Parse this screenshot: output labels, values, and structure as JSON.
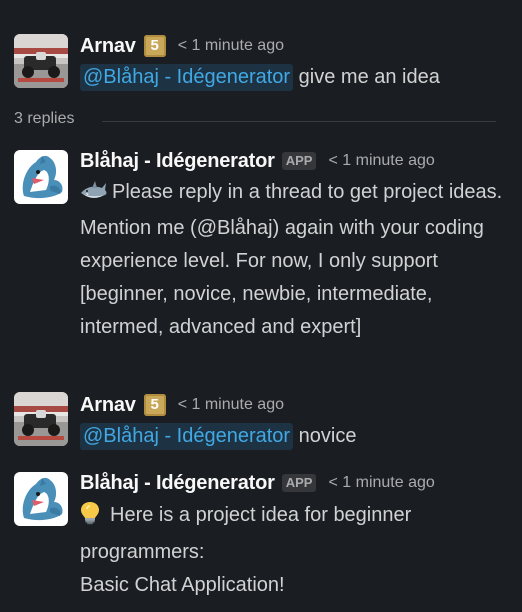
{
  "messages": [
    {
      "author": "Arnav",
      "badge": "5",
      "time": "< 1 minute ago",
      "mention": "@Blåhaj - Idégenerator",
      "text": "give me an idea"
    },
    {
      "author": "Blåhaj - Idégenerator",
      "app_badge": "APP",
      "time": "< 1 minute ago",
      "text": "Please reply in a thread to get project ideas. Mention me (@Blåhaj) again with your coding experience level. For now, I only support [beginner, novice, newbie, intermediate, intermed, advanced and expert]"
    },
    {
      "author": "Arnav",
      "badge": "5",
      "time": "< 1 minute ago",
      "mention": "@Blåhaj - Idégenerator",
      "text": "novice"
    },
    {
      "author": "Blåhaj - Idégenerator",
      "app_badge": "APP",
      "time": "< 1 minute ago",
      "text_line1": "Here is a project idea for beginner programmers:",
      "text_line2": "Basic Chat Application!"
    }
  ],
  "thread": {
    "replies_label": "3 replies"
  },
  "icons": {
    "shark_emoji": "shark-icon",
    "bulb_emoji": "lightbulb-icon"
  },
  "colors": {
    "background": "#1a1d21",
    "mention_text": "#41a8e4",
    "mention_bg": "#1d3344",
    "badge_gold": "#c9a85a"
  }
}
